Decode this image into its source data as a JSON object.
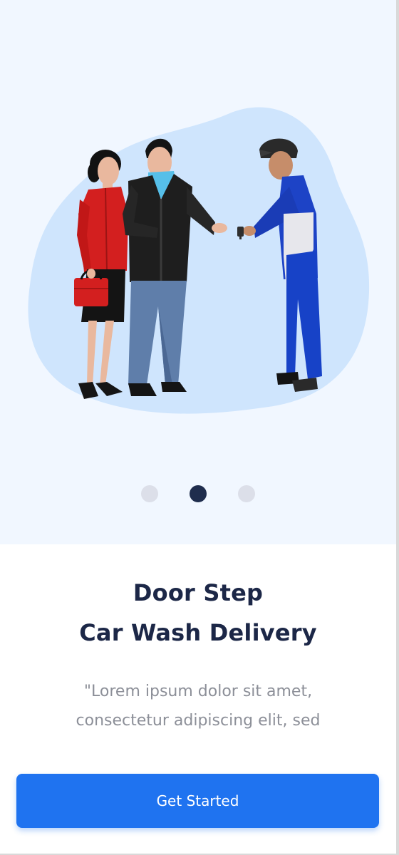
{
  "onboarding": {
    "title_line_1": "Door Step",
    "title_line_2": "Car Wash Delivery",
    "description_line_1": "\"Lorem ipsum dolor sit amet,",
    "description_line_2": "consectetur adipiscing elit, sed",
    "cta_label": "Get Started"
  },
  "pagination": {
    "current_page": 2,
    "total_pages": 3
  },
  "colors": {
    "hero_background": "#f1f7ff",
    "blob": "#cfe5fd",
    "title": "#1c2747",
    "body_text": "#8c8f98",
    "primary_button": "#1f73f0",
    "dot_active": "#1f2d4d",
    "dot_inactive": "#dcdfe9"
  },
  "illustration": {
    "icon": "car-key-handover-illustration"
  }
}
